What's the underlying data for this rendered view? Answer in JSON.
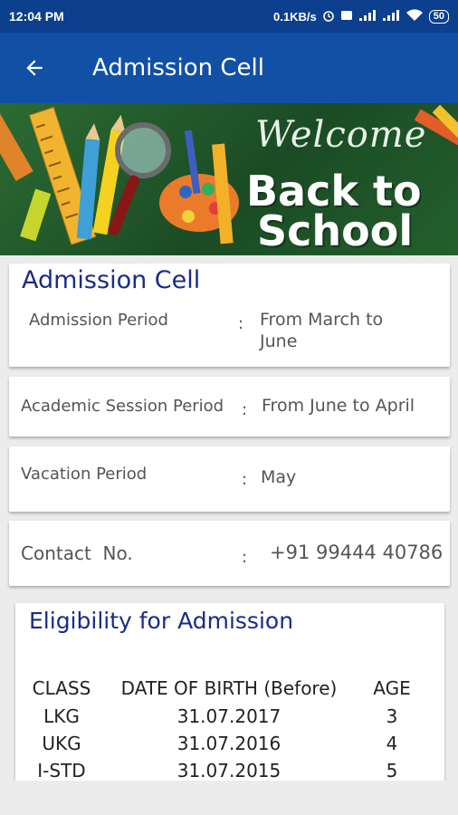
{
  "status_bar": {
    "time": "12:04 PM",
    "net_speed": "0.1KB/s",
    "battery": "50"
  },
  "app_bar": {
    "title": "Admission Cell"
  },
  "banner": {
    "welcome": "Welcome",
    "line1": "Back to",
    "line2": "School"
  },
  "admission_card": {
    "heading": "Admission Cell",
    "label": "Admission Period",
    "value_line1": "From March to",
    "value_line2": "June"
  },
  "session_card": {
    "label": "Academic Session Period",
    "value": "From June to April"
  },
  "vacation_card": {
    "label": "Vacation Period",
    "value": "May"
  },
  "contact_card": {
    "label": "Contact  No.",
    "value": "+91 99444 40786"
  },
  "colon": ":",
  "eligibility": {
    "heading": "Eligibility for Admission",
    "headers": {
      "class": "CLASS",
      "dob": "DATE OF BIRTH (Before)",
      "age": "AGE"
    },
    "rows": [
      {
        "class": "LKG",
        "dob": "31.07.2017",
        "age": "3"
      },
      {
        "class": "UKG",
        "dob": "31.07.2016",
        "age": "4"
      },
      {
        "class": "I-STD",
        "dob": "31.07.2015",
        "age": "5"
      }
    ]
  }
}
